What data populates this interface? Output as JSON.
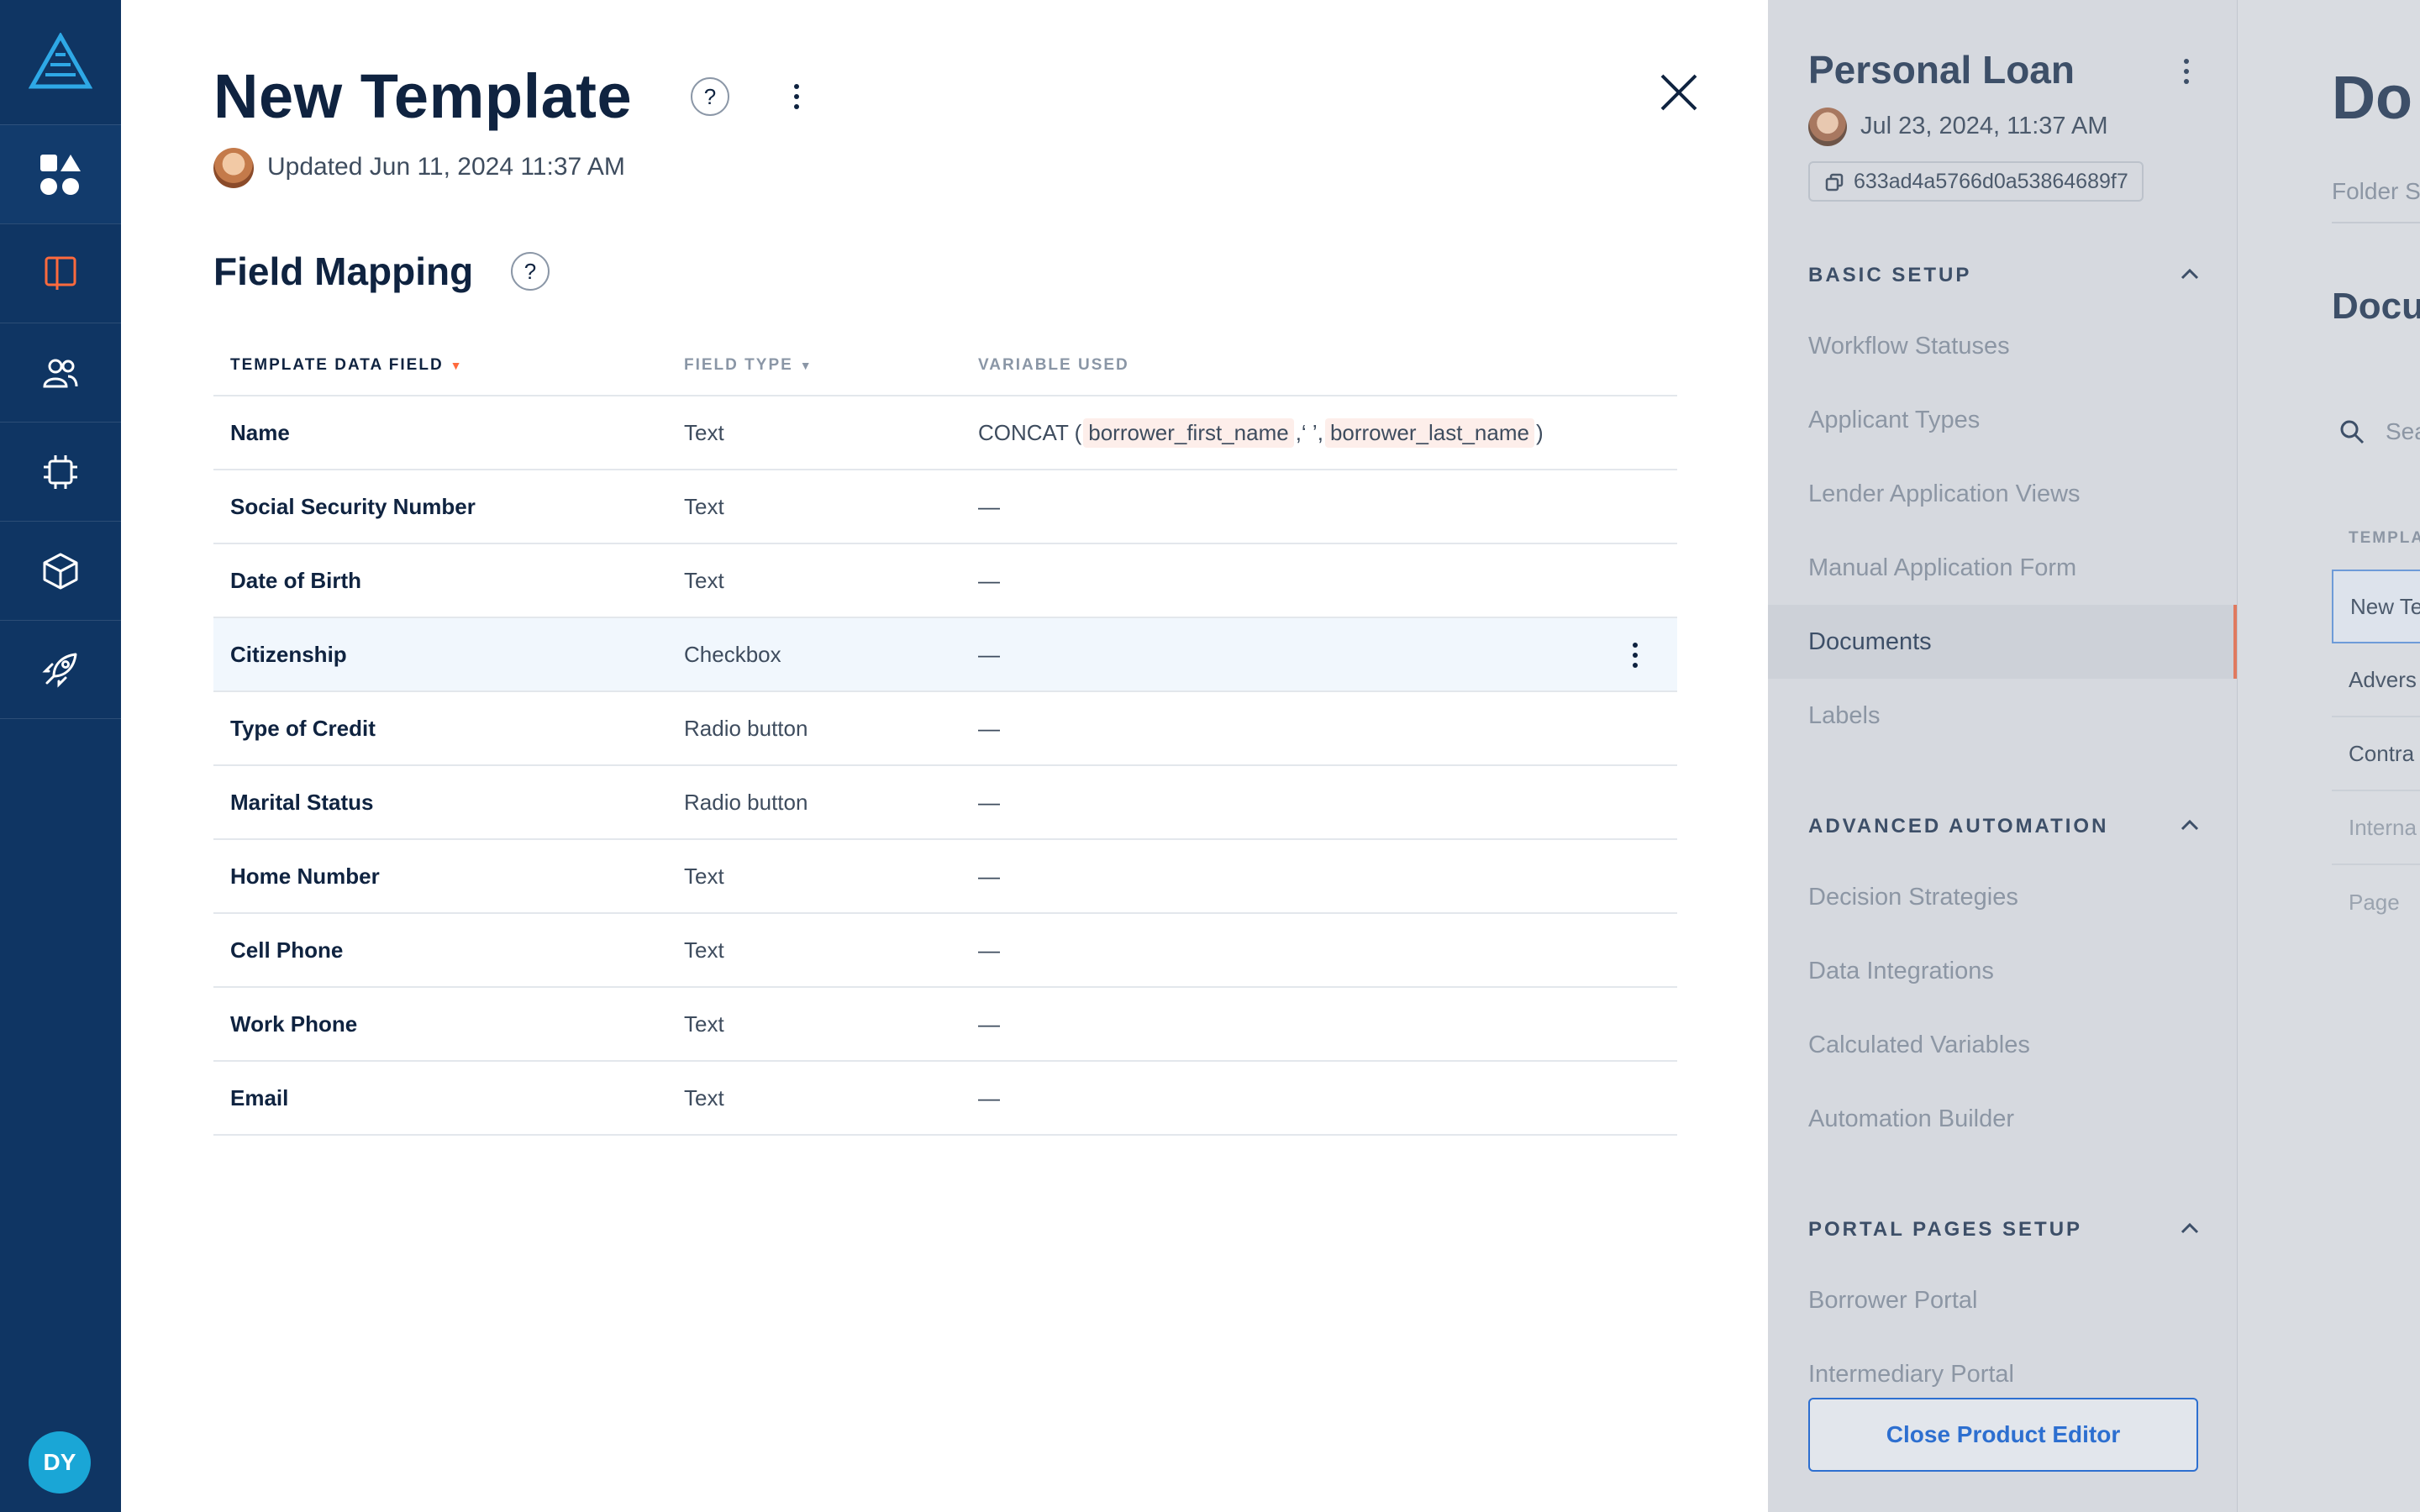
{
  "rail": {
    "avatar_initials": "DY",
    "items": [
      {
        "name": "apps-icon"
      },
      {
        "name": "book-icon"
      },
      {
        "name": "users-icon"
      },
      {
        "name": "chip-icon"
      },
      {
        "name": "box-icon"
      },
      {
        "name": "rocket-icon"
      }
    ]
  },
  "template": {
    "title": "New Template",
    "updated": "Updated Jun 11, 2024 11:37 AM",
    "help": "?"
  },
  "mapping": {
    "title": "Field Mapping",
    "help": "?",
    "columns": {
      "field": "TEMPLATE DATA FIELD",
      "type": "FIELD TYPE",
      "variable": "VARIABLE USED"
    },
    "concat": {
      "fn": "CONCAT (",
      "arg1": "borrower_first_name",
      "sep": ",‘ ’,",
      "arg2": "borrower_last_name",
      "close": ")"
    },
    "rows": [
      {
        "field": "Name",
        "type": "Text",
        "variable": ""
      },
      {
        "field": "Social Security Number",
        "type": "Text",
        "variable": "—"
      },
      {
        "field": "Date of Birth",
        "type": "Text",
        "variable": "—"
      },
      {
        "field": "Citizenship",
        "type": "Checkbox",
        "variable": "—"
      },
      {
        "field": "Type of Credit",
        "type": "Radio button",
        "variable": "—"
      },
      {
        "field": "Marital Status",
        "type": "Radio button",
        "variable": "—"
      },
      {
        "field": "Home Number",
        "type": "Text",
        "variable": "—"
      },
      {
        "field": "Cell Phone",
        "type": "Text",
        "variable": "—"
      },
      {
        "field": "Work Phone",
        "type": "Text",
        "variable": "—"
      },
      {
        "field": "Email",
        "type": "Text",
        "variable": "—"
      }
    ]
  },
  "product": {
    "title": "Personal Loan",
    "date": "Jul 23, 2024, 11:37 AM",
    "id": "633ad4a5766d0a53864689f7",
    "groups": [
      {
        "head": "BASIC SETUP",
        "items": [
          "Workflow Statuses",
          "Applicant Types",
          "Lender Application Views",
          "Manual Application Form",
          "Documents",
          "Labels"
        ]
      },
      {
        "head": "ADVANCED AUTOMATION",
        "items": [
          "Decision Strategies",
          "Data Integrations",
          "Calculated Variables",
          "Automation Builder"
        ]
      },
      {
        "head": "PORTAL PAGES SETUP",
        "items": [
          "Borrower Portal",
          "Intermediary Portal"
        ]
      }
    ],
    "close_button": "Close Product Editor"
  },
  "background_page": {
    "title": "Do",
    "subtitle": "Folder S",
    "heading": "Docu",
    "search_placeholder": "Sea",
    "column": "TEMPLA",
    "rows": [
      "New Te",
      "Advers",
      "Contra",
      "Interna",
      "Page"
    ]
  },
  "colors": {
    "rail": "#0f3563",
    "accent_orange": "#ff6a3d",
    "link_blue": "#2d6fd0",
    "text_dark": "#0f2340"
  }
}
